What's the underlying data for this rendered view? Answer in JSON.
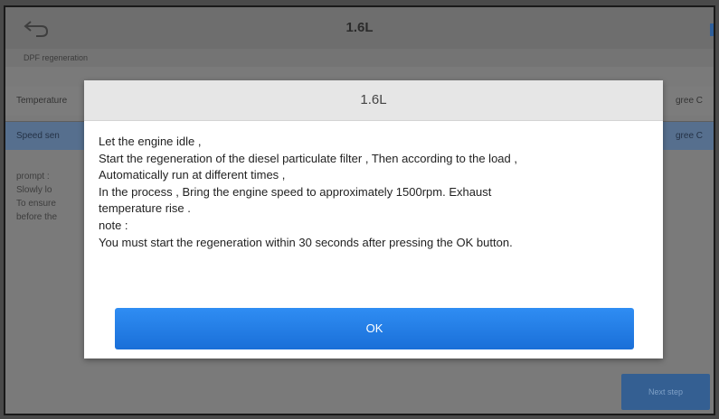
{
  "header": {
    "title": "1.6L"
  },
  "subbar": {
    "text": "DPF regeneration"
  },
  "rows": [
    {
      "left": "Temperature",
      "right": "gree C"
    },
    {
      "left": "Speed sen",
      "right": "gree C"
    }
  ],
  "background_text": [
    "prompt :",
    "Slowly lo",
    "To ensure",
    "before the"
  ],
  "background_button_label": "Next step",
  "dialog": {
    "title": "1.6L",
    "lines": [
      "Let the engine idle ,",
      "Start the regeneration of the diesel particulate filter , Then according to the load ,",
      "Automatically run at different times ,",
      "In the process , Bring the engine speed to approximately 1500rpm. Exhaust",
      "temperature rise .",
      "note :",
      "You must start the regeneration within 30 seconds after pressing the OK button."
    ],
    "ok_label": "OK"
  },
  "colors": {
    "accent": "#1a6fd8",
    "header_bg": "#e6e6e6"
  }
}
